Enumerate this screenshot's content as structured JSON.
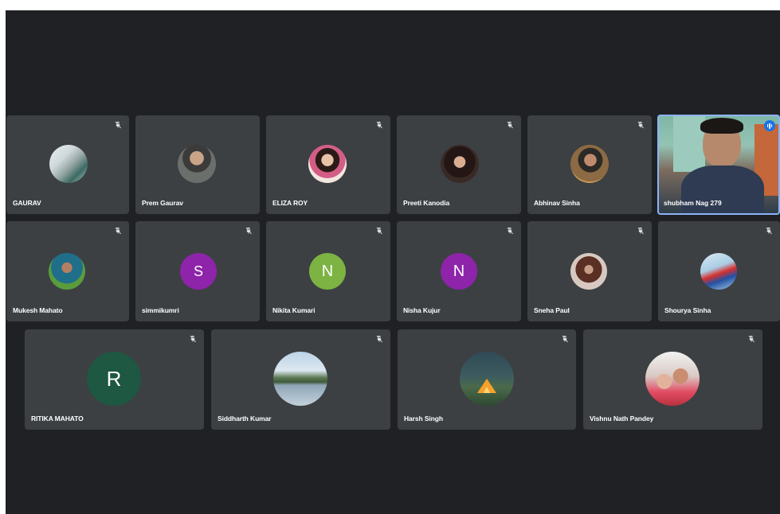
{
  "meeting": {
    "participants_row1": [
      {
        "name": "GAURAV",
        "avatar": "photo",
        "muted": true
      },
      {
        "name": "Prem Gaurav",
        "avatar": "photo",
        "muted": false
      },
      {
        "name": "ELIZA ROY",
        "avatar": "photo",
        "muted": true
      },
      {
        "name": "Preeti Kanodia",
        "avatar": "photo",
        "muted": true
      },
      {
        "name": "Abhinav Sinha",
        "avatar": "photo",
        "muted": true
      },
      {
        "name": "shubham Nag 279",
        "avatar": "video",
        "speaking": true
      }
    ],
    "participants_row2": [
      {
        "name": "Mukesh Mahato",
        "avatar": "photo",
        "muted": true
      },
      {
        "name": "simmikumri",
        "avatar_letter": "S",
        "avatar_color": "#8e24aa",
        "muted": true
      },
      {
        "name": "Nikita Kumari",
        "avatar_letter": "N",
        "avatar_color": "#7cb342",
        "muted": true
      },
      {
        "name": "Nisha Kujur",
        "avatar_letter": "N",
        "avatar_color": "#8e24aa",
        "muted": true
      },
      {
        "name": "Sneha Paul",
        "avatar": "photo",
        "muted": true
      },
      {
        "name": "Shourya Sinha",
        "avatar": "photo",
        "muted": true
      }
    ],
    "participants_row3": [
      {
        "name": "RITIKA MAHATO",
        "avatar_letter": "R",
        "avatar_color": "#1e5742",
        "muted": true
      },
      {
        "name": "Siddharth Kumar",
        "avatar": "photo",
        "muted": true
      },
      {
        "name": "Harsh Singh",
        "avatar": "photo",
        "muted": true
      },
      {
        "name": "Vishnu Nath Pandey",
        "avatar": "photo",
        "muted": true
      }
    ]
  },
  "colors": {
    "background": "#202124",
    "tile": "#3c4043",
    "speaking_border": "#8ab4f8",
    "speaking_indicator": "#1a73e8"
  }
}
